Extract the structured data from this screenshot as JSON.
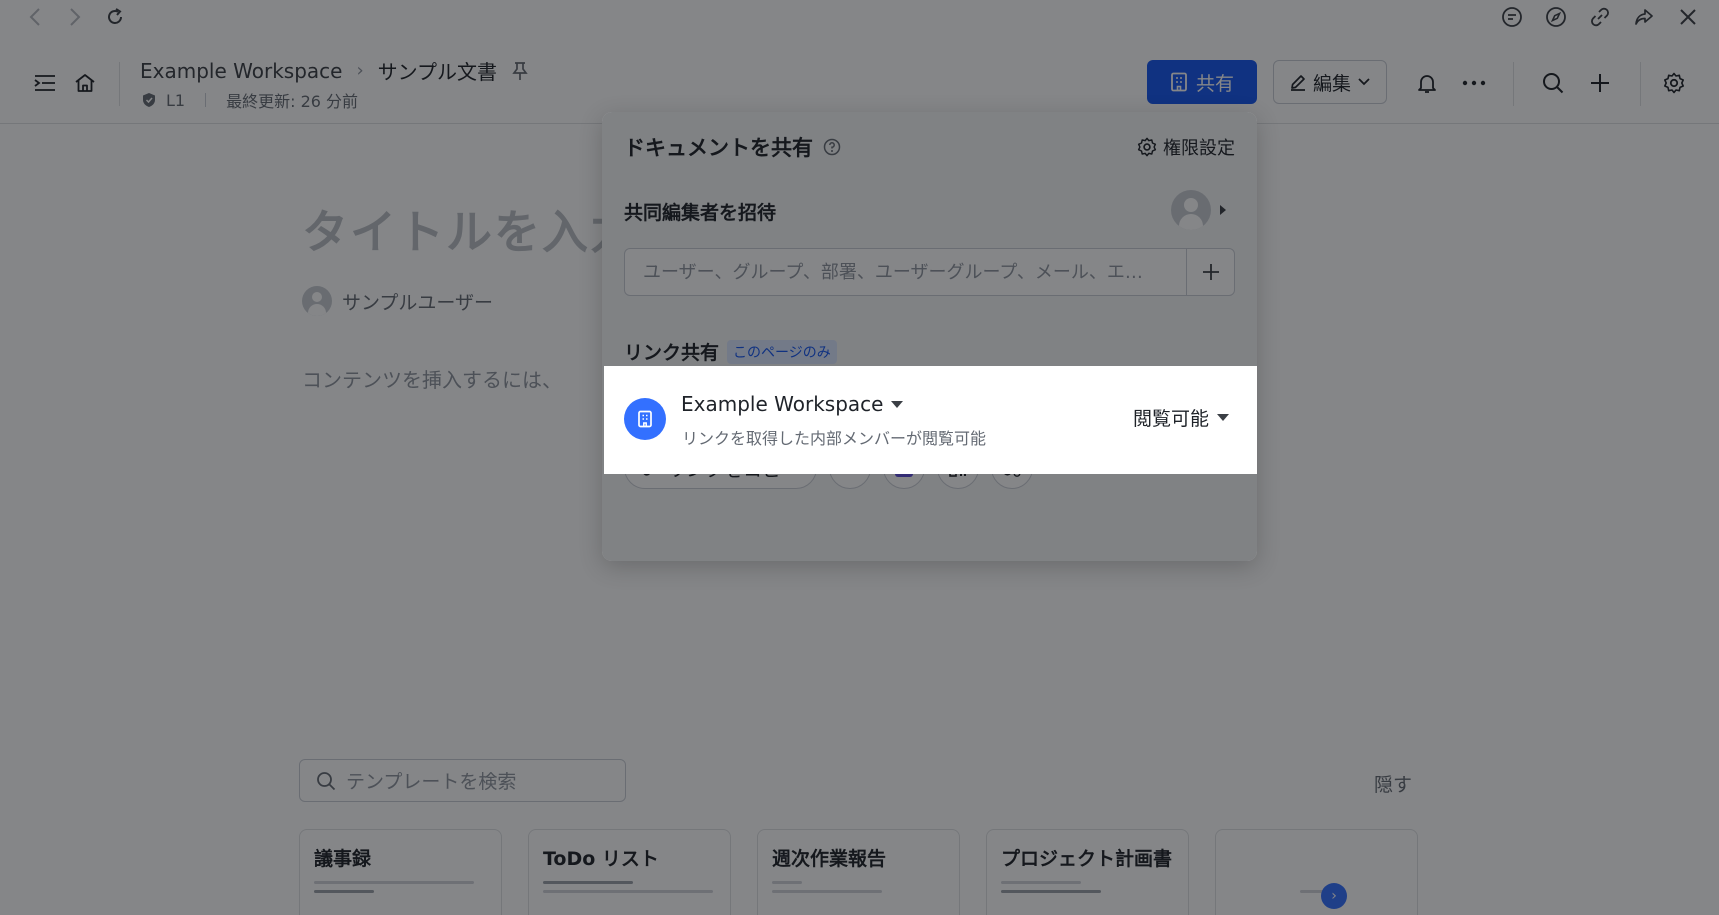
{
  "header": {
    "workspace": "Example Workspace",
    "separator": "›",
    "doc_name": "サンプル文書",
    "level": "L1",
    "last_updated": "最終更新: 26 分前",
    "share_label": "共有",
    "edit_label": "編集"
  },
  "document": {
    "title_placeholder": "タイトルを入力",
    "author": "サンプルユーザー",
    "content_hint": "コンテンツを挿入するには、"
  },
  "templates": {
    "search_placeholder": "テンプレートを検索",
    "hide_label": "隠す",
    "items": [
      {
        "name": "議事録"
      },
      {
        "name": "ToDo リスト"
      },
      {
        "name": "週次作業報告"
      },
      {
        "name": "プロジェクト計画書"
      },
      {
        "name": ""
      }
    ]
  },
  "share_dialog": {
    "title": "ドキュメントを共有",
    "permission_settings": "権限設定",
    "invite_label": "共同編集者を招待",
    "invite_placeholder": "ユーザー、グループ、部署、ユーザーグループ、メール、エ…",
    "link_share_label": "リンク共有",
    "page_only_tag": "このページのみ",
    "link_scope": {
      "name": "Example Workspace",
      "description": "リンクを取得した内部メンバーが閲覧可能",
      "access": "閲覧可能"
    },
    "copy_link_label": "リンクをコピー"
  },
  "colors": {
    "primary": "#1456f0",
    "workspace_icon": "#3370ff",
    "overlay": "rgba(12,14,18,0.5)"
  }
}
